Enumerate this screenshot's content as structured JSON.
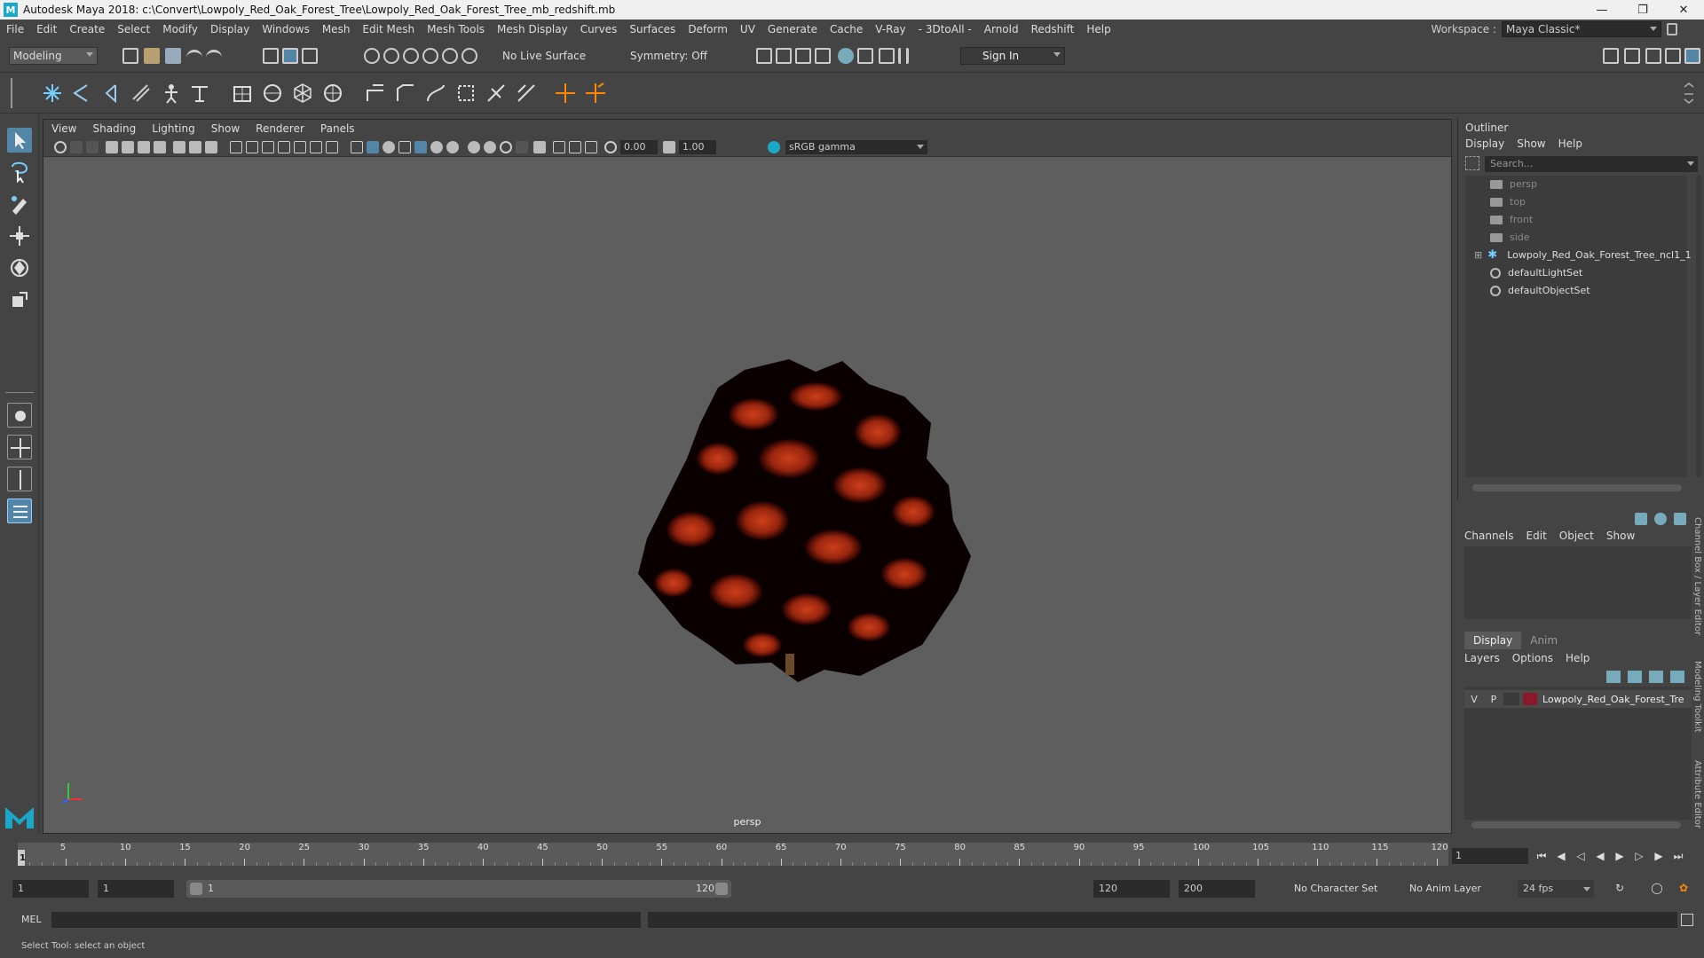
{
  "window": {
    "title": "Autodesk Maya 2018: c:\\Convert\\Lowpoly_Red_Oak_Forest_Tree\\Lowpoly_Red_Oak_Forest_Tree_mb_redshift.mb",
    "app_icon_letter": "M"
  },
  "menubar": {
    "items": [
      "File",
      "Edit",
      "Create",
      "Select",
      "Modify",
      "Display",
      "Windows",
      "Mesh",
      "Edit Mesh",
      "Mesh Tools",
      "Mesh Display",
      "Curves",
      "Surfaces",
      "Deform",
      "UV",
      "Generate",
      "Cache",
      "V-Ray",
      "- 3DtoAll -",
      "Arnold",
      "Redshift",
      "Help"
    ],
    "workspace_label": "Workspace :",
    "workspace_value": "Maya Classic*"
  },
  "statusline": {
    "mode": "Modeling",
    "live_surface": "No Live Surface",
    "symmetry": "Symmetry: Off",
    "sign_in": "Sign In"
  },
  "viewport": {
    "menu": [
      "View",
      "Shading",
      "Lighting",
      "Show",
      "Renderer",
      "Panels"
    ],
    "exposure": "0.00",
    "gamma": "1.00",
    "color_space": "sRGB gamma",
    "camera": "persp"
  },
  "outliner": {
    "title": "Outliner",
    "menu": [
      "Display",
      "Show",
      "Help"
    ],
    "search_placeholder": "Search...",
    "items": [
      {
        "label": "persp",
        "icon": "camera-icon",
        "dim": true
      },
      {
        "label": "top",
        "icon": "camera-icon",
        "dim": true
      },
      {
        "label": "front",
        "icon": "camera-icon",
        "dim": true
      },
      {
        "label": "side",
        "icon": "camera-icon",
        "dim": true
      },
      {
        "label": "Lowpoly_Red_Oak_Forest_Tree_ncl1_1",
        "icon": "transform-icon",
        "dim": false
      },
      {
        "label": "defaultLightSet",
        "icon": "set-icon",
        "dim": false
      },
      {
        "label": "defaultObjectSet",
        "icon": "set-icon",
        "dim": false
      }
    ]
  },
  "channelbox": {
    "menu": [
      "Channels",
      "Edit",
      "Object",
      "Show"
    ]
  },
  "layereditor": {
    "tabs": [
      "Display",
      "Anim"
    ],
    "menu": [
      "Layers",
      "Options",
      "Help"
    ],
    "layer": {
      "v": "V",
      "p": "P",
      "name": "Lowpoly_Red_Oak_Forest_Tree",
      "color": "#8a1a2a"
    }
  },
  "side_tabs": [
    "Channel Box / Layer Editor",
    "Modeling Toolkit",
    "Attribute Editor"
  ],
  "timeline": {
    "ticks": [
      5,
      10,
      15,
      20,
      25,
      30,
      35,
      40,
      45,
      50,
      55,
      60,
      65,
      70,
      75,
      80,
      85,
      90,
      95,
      100,
      105,
      110,
      115,
      120
    ],
    "start_marker": "1",
    "current_frame": "1"
  },
  "range": {
    "start": "1",
    "playback_start": "1",
    "bar_start": "1",
    "bar_end": "120",
    "playback_end": "120",
    "end": "200",
    "character_set": "No Character Set",
    "anim_layer": "No Anim Layer",
    "fps": "24 fps"
  },
  "cmdline": {
    "label": "MEL"
  },
  "helpline": {
    "text": "Select Tool: select an object"
  }
}
